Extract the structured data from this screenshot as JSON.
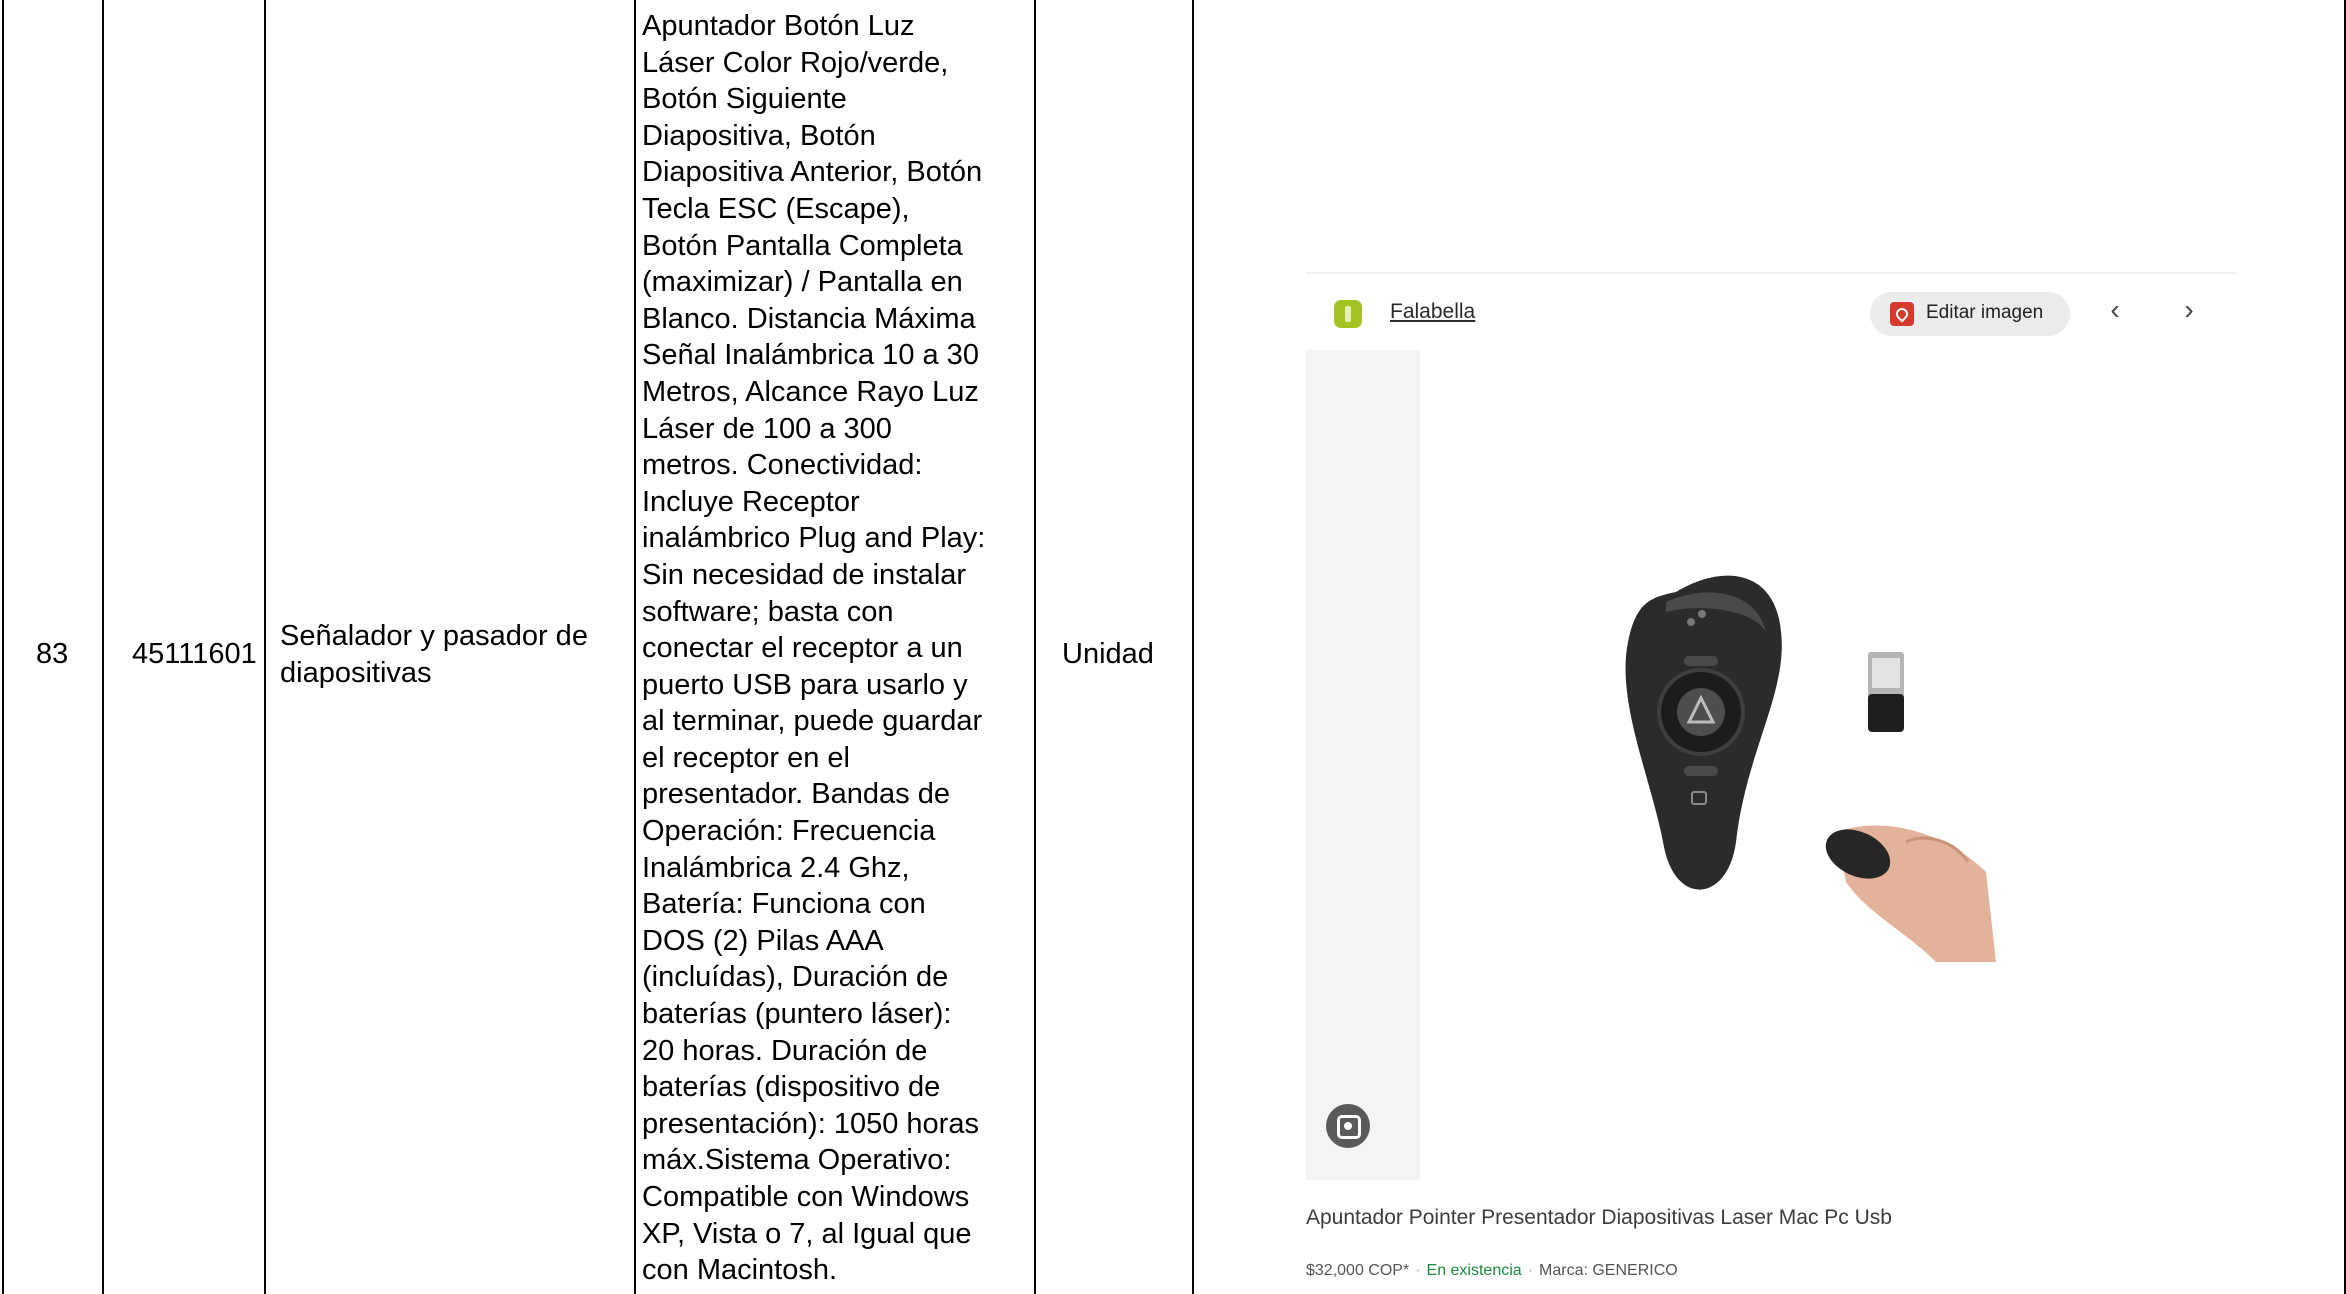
{
  "row": {
    "number": "83",
    "code": "45111601",
    "name": "Señalador y pasador de\ndiapositivas",
    "description": "Apuntador Botón Luz\nLáser Color Rojo/verde,\nBotón Siguiente\nDiapositiva, Botón\nDiapositiva Anterior, Botón\nTecla ESC (Escape),\nBotón Pantalla Completa\n(maximizar) / Pantalla en\nBlanco. Distancia Máxima\nSeñal Inalámbrica 10 a 30\nMetros, Alcance Rayo Luz\nLáser de 100 a 300\nmetros. Conectividad:\nIncluye Receptor\ninalámbrico Plug and Play:\nSin necesidad de instalar\nsoftware; basta con\nconectar el receptor a un\npuerto USB para usarlo y\nal terminar, puede guardar\nel receptor en el\npresentador. Bandas de\nOperación: Frecuencia\nInalámbrica 2.4 Ghz,\nBatería: Funciona con\nDOS (2) Pilas AAA\n(incluídas), Duración de\nbaterías (puntero láser):\n20 horas. Duración de\nbaterías (dispositivo de\npresentación): 1050 horas\nmáx.Sistema Operativo:\nCompatible con Windows\nXP, Vista o 7, al Igual que\ncon Macintosh.",
    "unit": "Unidad"
  },
  "screenshot": {
    "source": "Falabella",
    "edit_button": "Editar imagen",
    "prev": "‹",
    "next": "›",
    "product_title": "Apuntador Pointer Presentador Diapositivas Laser Mac Pc Usb",
    "price": "$32,000 COP*",
    "stock": "En existencia",
    "brand": "Marca: GENERICO"
  },
  "colors": {
    "favicon": "#a4c424",
    "pdf_icon": "#d63a2f",
    "stock_green": "#1b8a3c"
  }
}
